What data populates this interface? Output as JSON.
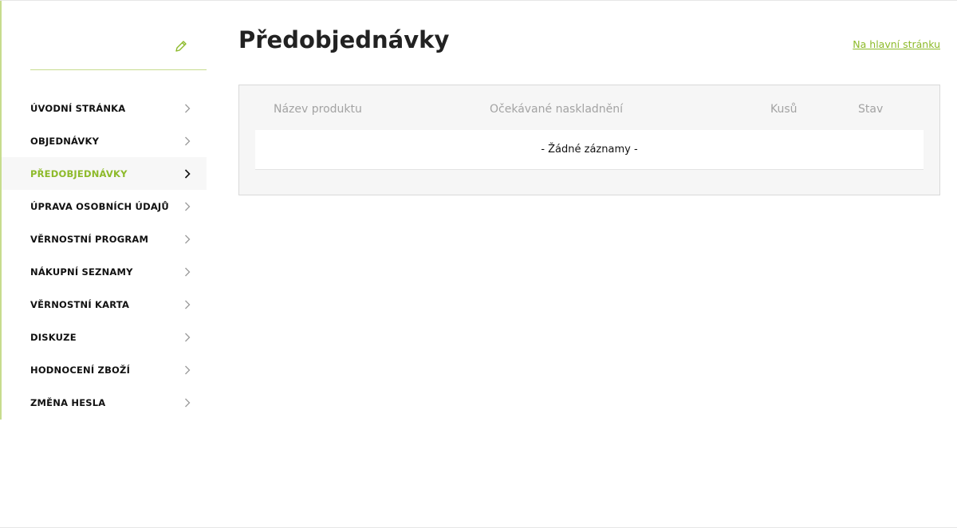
{
  "sidebar": {
    "edit_icon": "pencil-icon",
    "accent_color": "#c7dc8e",
    "items": [
      {
        "label": "ÚVODNÍ STRÁNKA",
        "active": false
      },
      {
        "label": "OBJEDNÁVKY",
        "active": false
      },
      {
        "label": "PŘEDOBJEDNÁVKY",
        "active": true
      },
      {
        "label": "ÚPRAVA OSOBNÍCH ÚDAJŮ",
        "active": false
      },
      {
        "label": "VĚRNOSTNÍ PROGRAM",
        "active": false
      },
      {
        "label": "NÁKUPNÍ SEZNAMY",
        "active": false
      },
      {
        "label": "VĚRNOSTNÍ KARTA",
        "active": false
      },
      {
        "label": "DISKUZE",
        "active": false
      },
      {
        "label": "HODNOCENÍ ZBOŽÍ",
        "active": false
      },
      {
        "label": "ZMĚNA HESLA",
        "active": false
      }
    ]
  },
  "main": {
    "title": "Předobjednávky",
    "home_link": "Na hlavní stránku",
    "brand_color": "#8dba2a",
    "table": {
      "columns": [
        "Název produktu",
        "Očekávané naskladnění",
        "Kusů",
        "Stav"
      ],
      "empty_message": "- Žádné záznamy -"
    }
  }
}
